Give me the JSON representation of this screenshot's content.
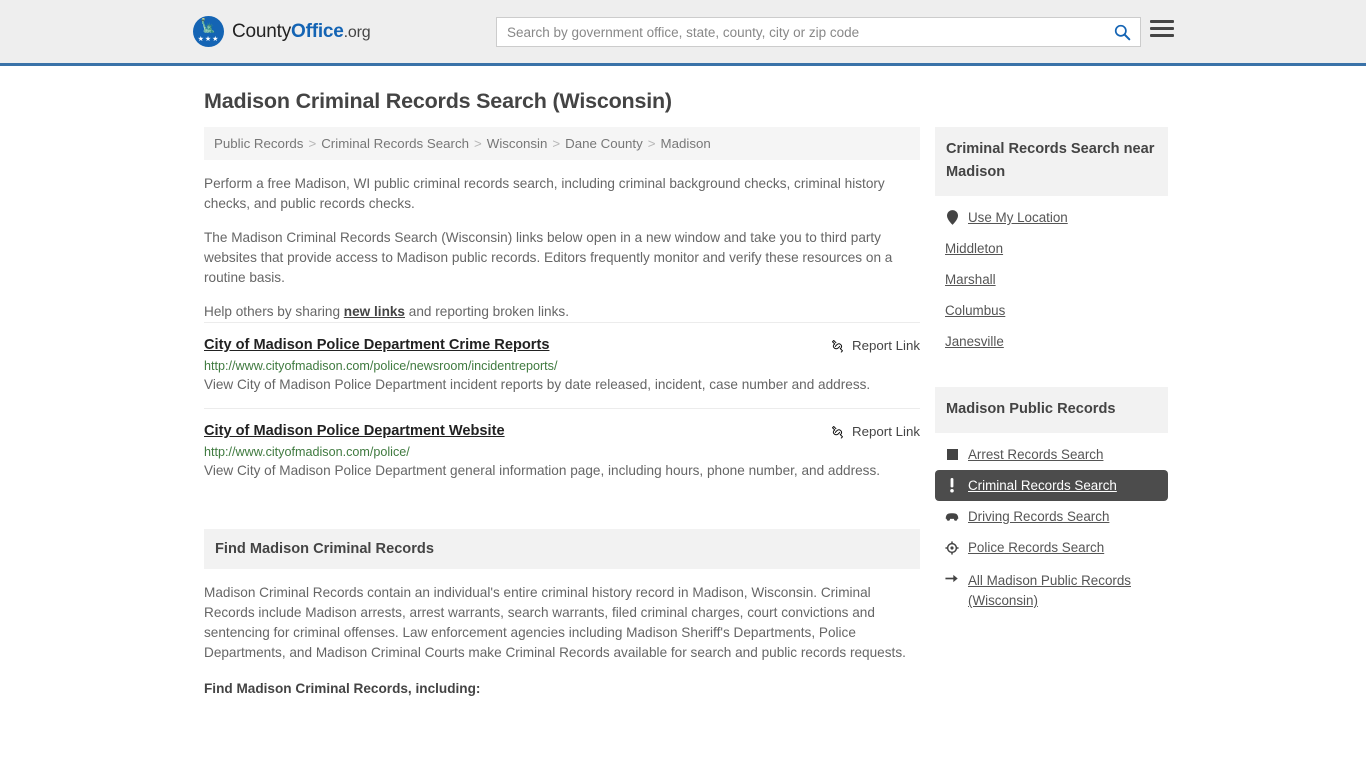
{
  "header": {
    "logo": {
      "part1": "County",
      "part2": "Office",
      "part3": ".org"
    },
    "search": {
      "placeholder": "Search by government office, state, county, city or zip code",
      "value": "",
      "icon": "search-icon"
    },
    "menu_icon": "hamburger-menu-icon",
    "accent_color": "#3a72a8"
  },
  "page": {
    "title": "Madison Criminal Records Search (Wisconsin)"
  },
  "breadcrumb": {
    "separator": ">",
    "items": [
      {
        "label": "Public Records"
      },
      {
        "label": "Criminal Records Search"
      },
      {
        "label": "Wisconsin"
      },
      {
        "label": "Dane County"
      },
      {
        "label": "Madison"
      }
    ]
  },
  "intro": {
    "p1": "Perform a free Madison, WI public criminal records search, including criminal background checks, criminal history checks, and public records checks.",
    "p2": "The Madison Criminal Records Search (Wisconsin) links below open in a new window and take you to third party websites that provide access to Madison public records. Editors frequently monitor and verify these resources on a routine basis.",
    "p3_before": "Help others by sharing ",
    "p3_link": "new links",
    "p3_after": " and reporting broken links."
  },
  "results": [
    {
      "title": "City of Madison Police Department Crime Reports",
      "url": "http://www.cityofmadison.com/police/newsroom/incidentreports/",
      "description": "View City of Madison Police Department incident reports by date released, incident, case number and address.",
      "report_label": "Report Link",
      "report_icon": "broken-link-icon"
    },
    {
      "title": "City of Madison Police Department Website",
      "url": "http://www.cityofmadison.com/police/",
      "description": "View City of Madison Police Department general information page, including hours, phone number, and address.",
      "report_label": "Report Link",
      "report_icon": "broken-link-icon"
    }
  ],
  "find_section": {
    "heading": "Find Madison Criminal Records",
    "paragraph": "Madison Criminal Records contain an individual's entire criminal history record in Madison, Wisconsin. Criminal Records include Madison arrests, arrest warrants, search warrants, filed criminal charges, court convictions and sentencing for criminal offenses. Law enforcement agencies including Madison Sheriff's Departments, Police Departments, and Madison Criminal Courts make Criminal Records available for search and public records requests.",
    "subheading": "Find Madison Criminal Records, including:"
  },
  "sidebar": {
    "near_panel": {
      "heading": "Criminal Records Search near Madison",
      "items": [
        {
          "label": "Use My Location",
          "icon": "map-pin-icon",
          "has_icon": true
        },
        {
          "label": "Middleton",
          "icon": "",
          "has_icon": false
        },
        {
          "label": "Marshall",
          "icon": "",
          "has_icon": false
        },
        {
          "label": "Columbus",
          "icon": "",
          "has_icon": false
        },
        {
          "label": "Janesville",
          "icon": "",
          "has_icon": false
        }
      ]
    },
    "records_panel": {
      "heading": "Madison Public Records",
      "active_color": "#4c4c4c",
      "items": [
        {
          "label": "Arrest Records Search",
          "icon": "fingerprint-icon",
          "active": false
        },
        {
          "label": "Criminal Records Search",
          "icon": "exclamation-icon",
          "active": true
        },
        {
          "label": "Driving Records Search",
          "icon": "car-icon",
          "active": false
        },
        {
          "label": "Police Records Search",
          "icon": "police-badge-icon",
          "active": false
        },
        {
          "label": "All Madison Public Records (Wisconsin)",
          "icon": "arrow-right-icon",
          "active": false
        }
      ]
    }
  }
}
